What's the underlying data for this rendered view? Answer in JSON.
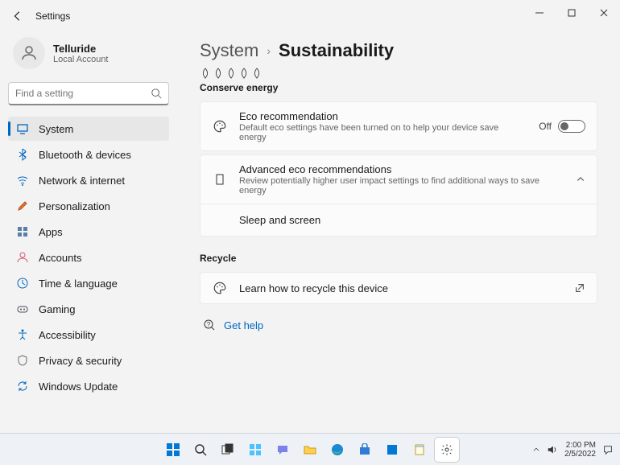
{
  "window": {
    "title": "Settings"
  },
  "account": {
    "name": "Telluride",
    "type": "Local Account"
  },
  "search": {
    "placeholder": "Find a setting"
  },
  "nav": [
    {
      "label": "System",
      "selected": true,
      "icon": "system"
    },
    {
      "label": "Bluetooth & devices",
      "icon": "bluetooth"
    },
    {
      "label": "Network & internet",
      "icon": "wifi"
    },
    {
      "label": "Personalization",
      "icon": "brush"
    },
    {
      "label": "Apps",
      "icon": "apps"
    },
    {
      "label": "Accounts",
      "icon": "accounts"
    },
    {
      "label": "Time & language",
      "icon": "time"
    },
    {
      "label": "Gaming",
      "icon": "gaming"
    },
    {
      "label": "Accessibility",
      "icon": "accessibility"
    },
    {
      "label": "Privacy & security",
      "icon": "privacy"
    },
    {
      "label": "Windows Update",
      "icon": "update"
    }
  ],
  "breadcrumb": {
    "parent": "System",
    "current": "Sustainability"
  },
  "sections": {
    "conserve": {
      "title": "Conserve energy",
      "eco": {
        "title": "Eco recommendation",
        "desc": "Default eco settings have been turned on to help your device save energy",
        "state": "Off"
      },
      "advanced": {
        "title": "Advanced eco recommendations",
        "desc": "Review potentially higher user impact settings to find additional ways to save energy"
      },
      "sleep": "Sleep and screen"
    },
    "recycle": {
      "title": "Recycle",
      "learn": "Learn how to recycle this device"
    }
  },
  "help": {
    "label": "Get help"
  },
  "taskbar": {
    "time": "2:00 PM",
    "date": "2/5/2022"
  }
}
